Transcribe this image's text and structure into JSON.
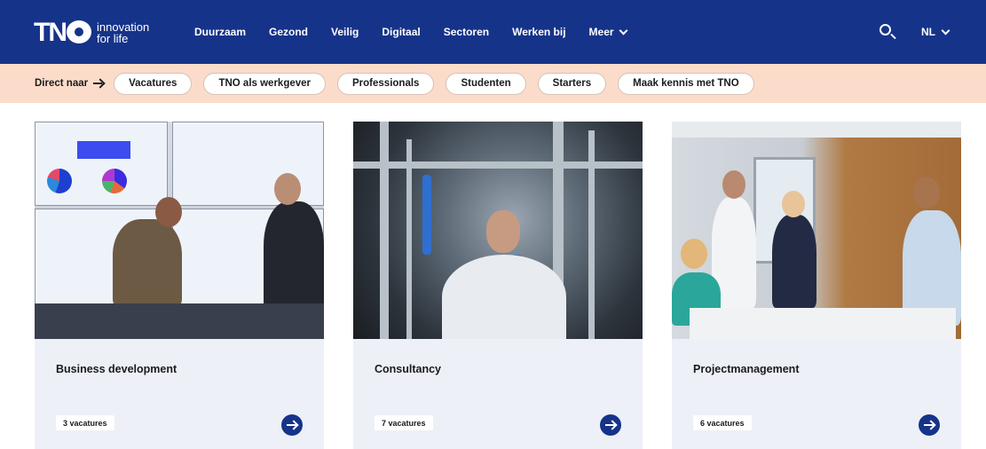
{
  "header": {
    "logo_text": "TNO",
    "tagline_line1": "innovation",
    "tagline_line2": "for life",
    "nav": [
      {
        "label": "Duurzaam"
      },
      {
        "label": "Gezond"
      },
      {
        "label": "Veilig"
      },
      {
        "label": "Digitaal"
      },
      {
        "label": "Sectoren"
      },
      {
        "label": "Werken bij"
      },
      {
        "label": "Meer"
      }
    ],
    "search_icon": "search-icon",
    "language": "NL",
    "bg_color": "#16338a"
  },
  "quicklinks": {
    "label": "Direct naar",
    "items": [
      {
        "label": "Vacatures"
      },
      {
        "label": "TNO als werkgever"
      },
      {
        "label": "Professionals"
      },
      {
        "label": "Studenten"
      },
      {
        "label": "Starters"
      },
      {
        "label": "Maak kennis met TNO"
      }
    ],
    "bg_color": "#fbdccb"
  },
  "cards": [
    {
      "title": "Business development",
      "count": "3 vacatures",
      "image": "control-room-photo"
    },
    {
      "title": "Consultancy",
      "count": "7 vacatures",
      "image": "lab-scientist-photo"
    },
    {
      "title": "Projectmanagement",
      "count": "6 vacatures",
      "image": "team-meeting-photo"
    }
  ],
  "card_bg_color": "#eef0f8",
  "accent_color": "#16338a"
}
